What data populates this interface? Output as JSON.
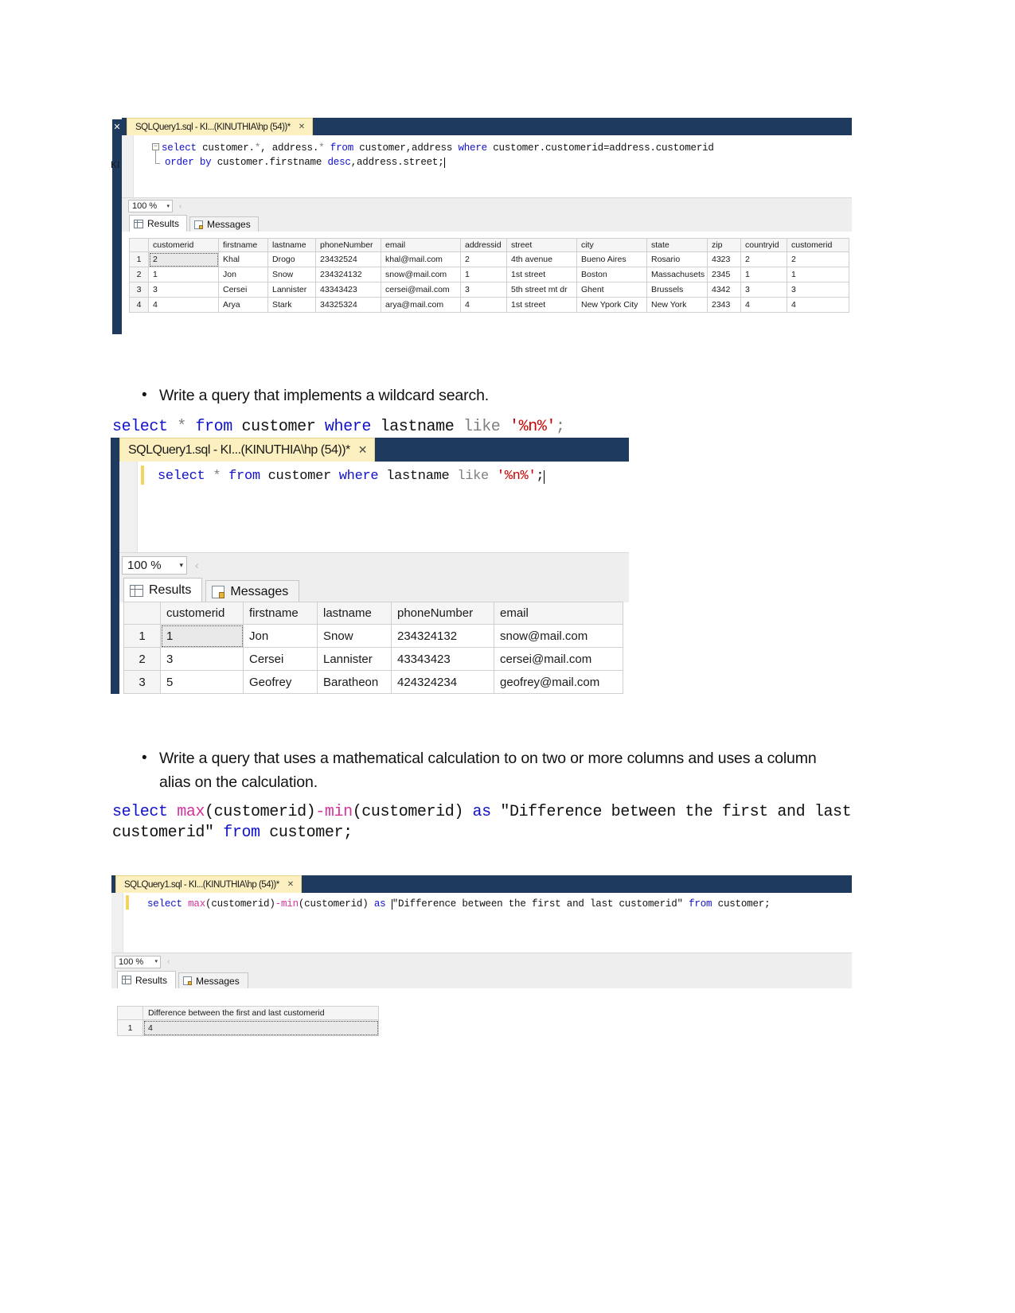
{
  "document": {
    "bullets": [
      {
        "text": "Write a query that implements a wildcard search."
      },
      {
        "text": "Write a query that uses a mathematical calculation to on two or more columns and uses a column alias on the calculation."
      }
    ],
    "code_snippets": {
      "wildcard": {
        "t1": "select",
        "t2": "*",
        "t3": "from",
        "t4": "customer",
        "t5": "where",
        "t6": "lastname",
        "t7": "like",
        "t8": "'%n%'",
        "t9": ";"
      },
      "calculation": {
        "t1": "select",
        "t2": "max",
        "t3": "(customerid)",
        "t4": "-",
        "t5": "min",
        "t6": "(customerid)",
        "t7": "as",
        "t8": "\"Difference between the first and last customerid\"",
        "t9": "from",
        "t10": "customer",
        "t11": ";"
      }
    }
  },
  "shots": {
    "shot1": {
      "tab": {
        "label": "SQLQuery1.sql - KI...(KINUTHIA\\hp (54))*",
        "close": "✕"
      },
      "outline_toggle": "−",
      "editor": {
        "line1": {
          "select": "select",
          "cust_star": " customer.",
          "star1": "*",
          "comma1": ", ",
          "addr_star": "address.",
          "star2": "*",
          "from": " from ",
          "tables": "customer",
          "comma2": ",",
          "tables2": "address",
          "where": " where ",
          "cond1": "customer.customerid",
          "eq": "=",
          "cond2": "address.customerid"
        },
        "line2": {
          "order": "order",
          "by": " by ",
          "col": "customer.firstname",
          "desc": " desc",
          "comma": ",",
          "col2": "address.street",
          "semi": ";"
        }
      },
      "zoom": {
        "value": "100 %",
        "arrow": "▾",
        "splitter": "‹"
      },
      "tabs": [
        {
          "label": "Results",
          "icon": "grid-icon",
          "active": true
        },
        {
          "label": "Messages",
          "icon": "messages-icon",
          "active": false
        }
      ],
      "grid": {
        "columns": [
          "",
          "customerid",
          "firstname",
          "lastname",
          "phoneNumber",
          "email",
          "addressid",
          "street",
          "city",
          "state",
          "zip",
          "countryid",
          "customerid"
        ],
        "rows": [
          [
            "1",
            "2",
            "Khal",
            "Drogo",
            "23432524",
            "khal@mail.com",
            "2",
            "4th avenue",
            "Bueno Aires",
            "Rosario",
            "4323",
            "2",
            "2"
          ],
          [
            "2",
            "1",
            "Jon",
            "Snow",
            "234324132",
            "snow@mail.com",
            "1",
            "1st street",
            "Boston",
            "Massachusets",
            "2345",
            "1",
            "1"
          ],
          [
            "3",
            "3",
            "Cersei",
            "Lannister",
            "43343423",
            "cersei@mail.com",
            "3",
            "5th street mt dr",
            "Ghent",
            "Brussels",
            "4342",
            "3",
            "3"
          ],
          [
            "4",
            "4",
            "Arya",
            "Stark",
            "34325324",
            "arya@mail.com",
            "4",
            "1st street",
            "New Ypork City",
            "New York",
            "2343",
            "4",
            "4"
          ]
        ]
      },
      "side_label": "KI",
      "side_close": "✕"
    },
    "shot2": {
      "tab": {
        "label": "SQLQuery1.sql - KI...(KINUTHIA\\hp (54))*",
        "close": "✕"
      },
      "editor": {
        "select": "select",
        "star": "*",
        "from": "from",
        "customer": "customer",
        "where": "where",
        "lastname": "lastname",
        "like": "like",
        "pattern": "'%n%'",
        "semi": ";"
      },
      "zoom": {
        "value": "100 %",
        "arrow": "▾",
        "splitter": "‹"
      },
      "tabs": [
        {
          "label": "Results",
          "icon": "grid-icon",
          "active": true
        },
        {
          "label": "Messages",
          "icon": "messages-icon",
          "active": false
        }
      ],
      "grid": {
        "columns": [
          "",
          "customerid",
          "firstname",
          "lastname",
          "phoneNumber",
          "email"
        ],
        "rows": [
          [
            "1",
            "1",
            "Jon",
            "Snow",
            "234324132",
            "snow@mail.com"
          ],
          [
            "2",
            "3",
            "Cersei",
            "Lannister",
            "43343423",
            "cersei@mail.com"
          ],
          [
            "3",
            "5",
            "Geofrey",
            "Baratheon",
            "424324234",
            "geofrey@mail.com"
          ]
        ]
      }
    },
    "shot3": {
      "tab": {
        "label": "SQLQuery1.sql - KI...(KINUTHIA\\hp (54))*",
        "close": "✕"
      },
      "editor": {
        "select": "select",
        "max": "max",
        "p1": "(customerid)",
        "minus": "-",
        "min": "min",
        "p2": "(customerid)",
        "as": "as",
        "alias": "\"Difference between the first and last customerid\"",
        "from": "from",
        "customer": "customer",
        "semi": ";"
      },
      "zoom": {
        "value": "100 %",
        "arrow": "▾",
        "splitter": "‹"
      },
      "tabs": [
        {
          "label": "Results",
          "icon": "grid-icon",
          "active": true
        },
        {
          "label": "Messages",
          "icon": "messages-icon",
          "active": false
        }
      ],
      "grid": {
        "columns": [
          "",
          "Difference between the first and last customerid"
        ],
        "rows": [
          [
            "1",
            "4"
          ]
        ]
      }
    }
  },
  "colors": {
    "titlebar": "#1f3a5f",
    "tab_active": "#fcf0c1",
    "keyword": "#1111cc",
    "string": "#cc0000",
    "function": "#d6329b",
    "comment_gray": "#808080"
  }
}
